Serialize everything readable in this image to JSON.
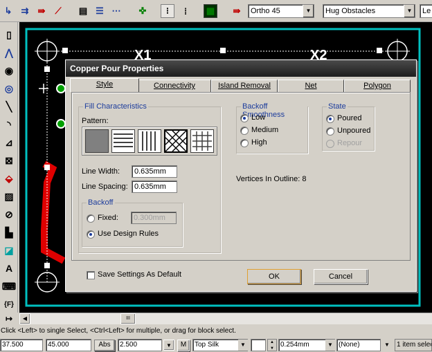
{
  "toolbar": {
    "routing_mode": "Ortho 45",
    "obstacle_mode": "Hug Obstacles",
    "overflow_combo": "Le"
  },
  "canvas": {
    "labels": [
      "X1",
      "X2"
    ]
  },
  "dialog": {
    "title": "Copper Pour Properties",
    "tabs": [
      {
        "label": "Style",
        "hotkey": "S"
      },
      {
        "label": "Connectivity",
        "hotkey": "C"
      },
      {
        "label": "Island Removal",
        "hotkey": "I"
      },
      {
        "label": "Net",
        "hotkey": "N"
      },
      {
        "label": "Polygon",
        "hotkey": "P"
      }
    ],
    "fill": {
      "title": "Fill Characteristics",
      "pattern_label": "Pattern:",
      "line_width_label": "Line Width:",
      "line_width_value": "0.635mm",
      "line_spacing_label": "Line Spacing:",
      "line_spacing_value": "0.635mm"
    },
    "backoff": {
      "title": "Backoff",
      "fixed_label": "Fixed:",
      "fixed_value": "0.300mm",
      "design_rules_label": "Use Design Rules",
      "selected": "design_rules"
    },
    "smoothness": {
      "title": "Backoff Smoothness",
      "options": [
        "Low",
        "Medium",
        "High"
      ],
      "selected": "Low"
    },
    "state": {
      "title": "State",
      "options": [
        "Poured",
        "Unpoured",
        "Repour"
      ],
      "selected": "Poured"
    },
    "vertices_label": "Vertices In Outline:",
    "vertices_value": "8",
    "save_default_label": "Save Settings As Default",
    "ok_label": "OK",
    "cancel_label": "Cancel"
  },
  "status": {
    "message": "Click <Left> to single Select, <Ctrl<Left> for multiple, or drag for block select.",
    "x": "37.500",
    "y": "45.000",
    "abs_label": "Abs",
    "grid": "2.500",
    "m_label": "M",
    "layer": "Top Silk",
    "width": "0.254mm",
    "net": "(None)",
    "selection": "1 item selec"
  },
  "scroll": {
    "thumb_glyph": "III"
  },
  "colors": {
    "canvas_bg": "#000000",
    "board_outline": "#00c0c0",
    "trace": "#e00000",
    "title_bar": "#1e1e1e",
    "group_title": "#1c3c9c"
  }
}
